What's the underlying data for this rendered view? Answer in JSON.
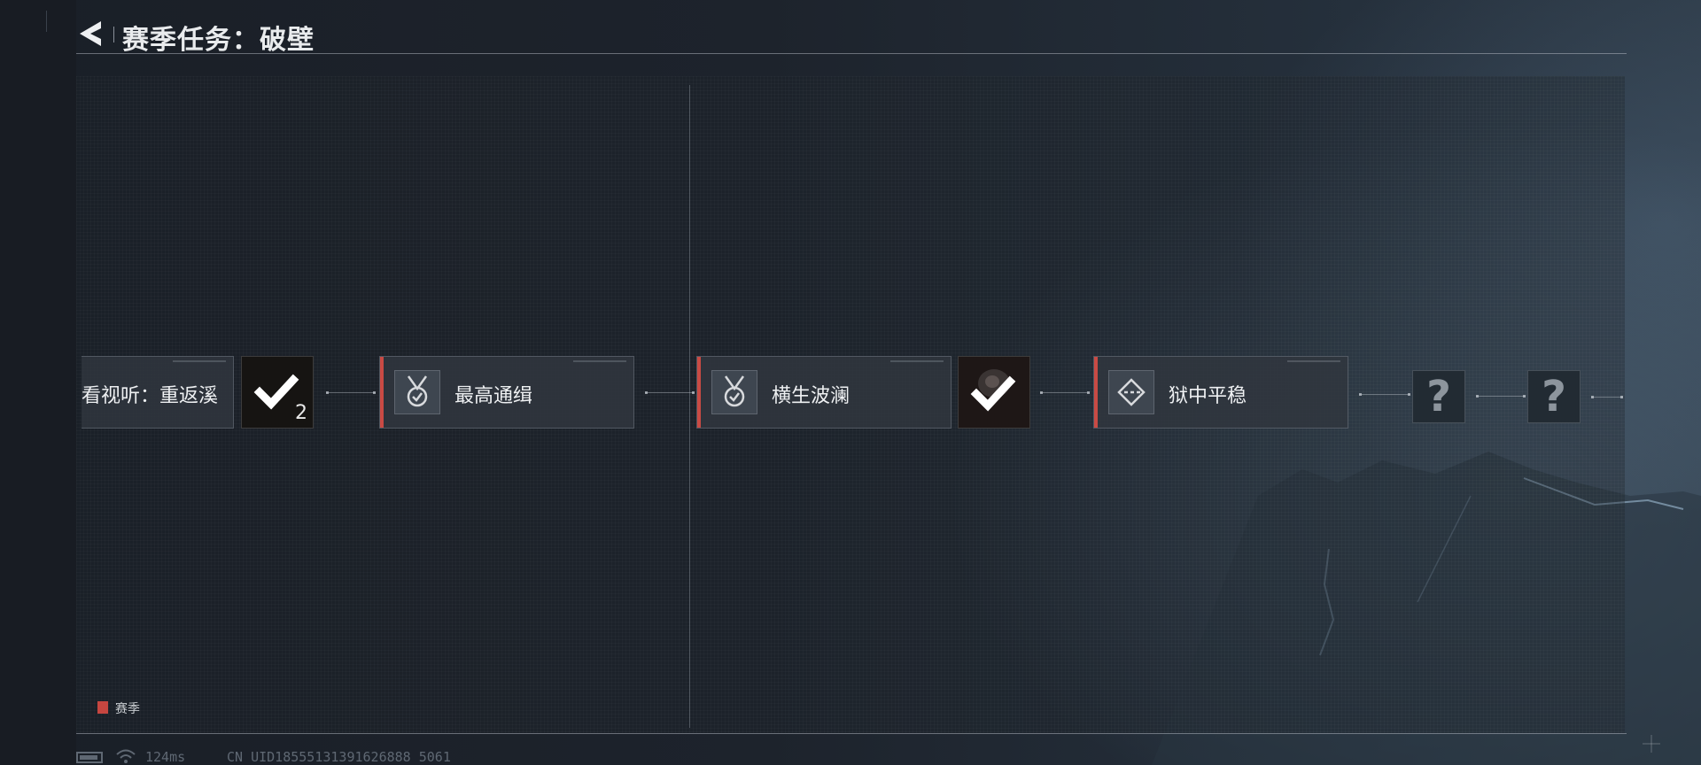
{
  "header": {
    "title": "赛季任务：破壁"
  },
  "nodes": [
    {
      "label": "看视听：重返溪",
      "icon": "season-card-cut"
    },
    {
      "label": "最高通缉",
      "icon": "medal-check-icon"
    },
    {
      "label": "横生波澜",
      "icon": "medal-check-icon"
    },
    {
      "label": "狱中平稳",
      "icon": "diamond-arrows-icon"
    }
  ],
  "rewards": [
    {
      "icon": "checkmark-icon",
      "count": "2"
    },
    {
      "icon": "checkmark-icon"
    }
  ],
  "locked": [
    {
      "symbol": "?"
    },
    {
      "symbol": "?"
    }
  ],
  "legend": {
    "label": "赛季",
    "color": "#c64640"
  },
  "status": {
    "ping": "124ms",
    "uid": "CN UID18555131391626888 5061"
  },
  "colors": {
    "accent_red": "#c94a44",
    "background": "#1c222b"
  }
}
